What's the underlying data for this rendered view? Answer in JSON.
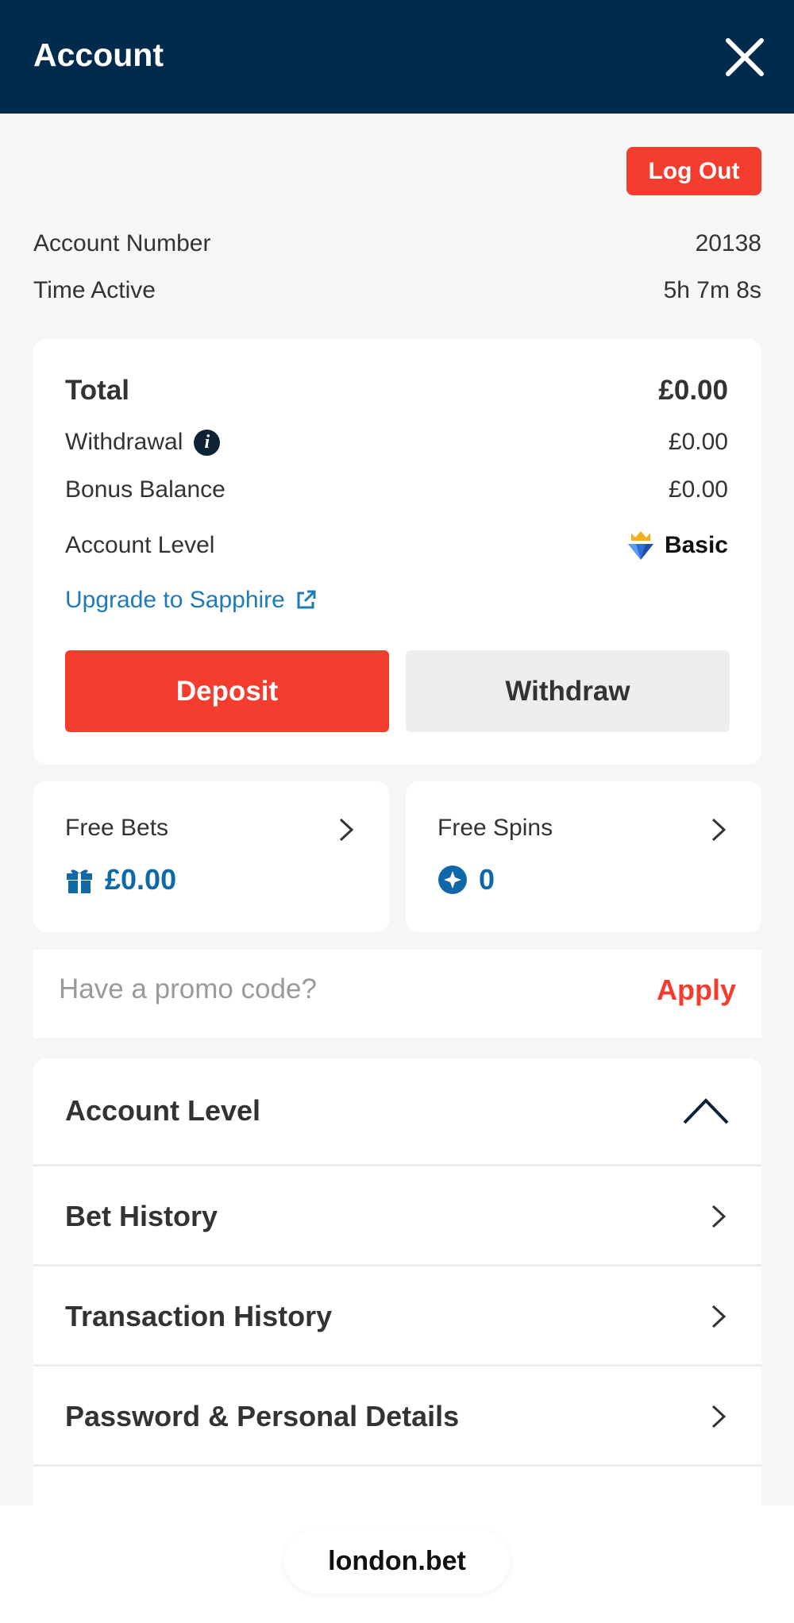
{
  "header": {
    "title": "Account",
    "close_icon": "close-icon"
  },
  "account": {
    "logout_label": "Log Out",
    "number_label": "Account Number",
    "number_value": "20138",
    "time_label": "Time Active",
    "time_value": "5h 7m 8s"
  },
  "balance": {
    "total_label": "Total",
    "total_value": "£0.00",
    "withdrawal_label": "Withdrawal",
    "withdrawal_value": "£0.00",
    "bonus_label": "Bonus Balance",
    "bonus_value": "£0.00",
    "level_label": "Account Level",
    "level_value": "Basic",
    "upgrade_label": "Upgrade to Sapphire",
    "deposit_label": "Deposit",
    "withdraw_label": "Withdraw"
  },
  "free_bets": {
    "label": "Free Bets",
    "value": "£0.00",
    "icon": "gift-icon"
  },
  "free_spins": {
    "label": "Free Spins",
    "value": "0",
    "icon": "spin-star-icon"
  },
  "promo": {
    "placeholder": "Have a promo code?",
    "apply_label": "Apply"
  },
  "menu": {
    "items": [
      {
        "label": "Account Level",
        "icon": "chevron-up-icon"
      },
      {
        "label": "Bet History",
        "icon": "chevron-right-icon"
      },
      {
        "label": "Transaction History",
        "icon": "chevron-right-icon"
      },
      {
        "label": "Password & Personal Details",
        "icon": "chevron-right-icon"
      }
    ]
  },
  "browser": {
    "url": "london.bet"
  },
  "colors": {
    "header": "#012b4d",
    "accent_red": "#f53d2f",
    "link_blue": "#1f7ab9",
    "value_blue": "#0f69a8"
  }
}
